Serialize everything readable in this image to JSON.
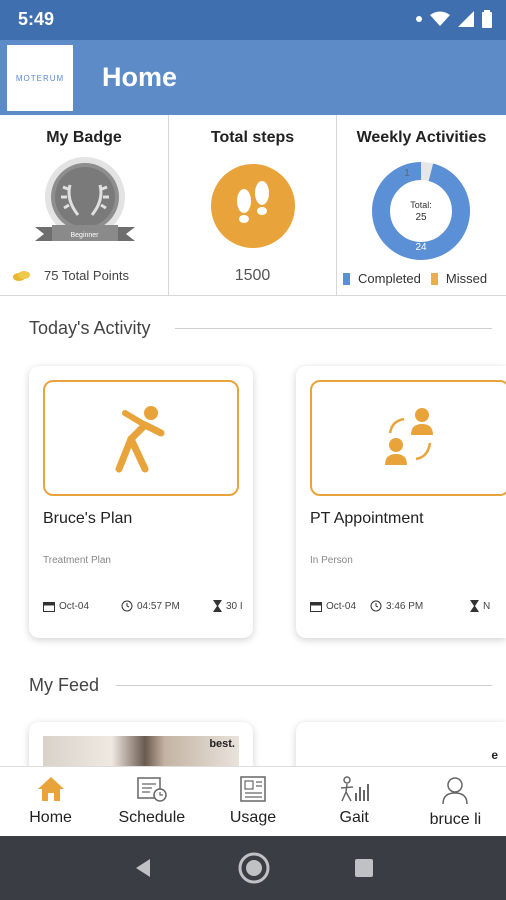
{
  "status_bar": {
    "time": "5:49"
  },
  "header": {
    "logo_text": "MOTERUM",
    "title": "Home"
  },
  "badge": {
    "title": "My Badge",
    "level": "Beginner",
    "points": "75 Total Points"
  },
  "steps": {
    "title": "Total steps",
    "count": "1500"
  },
  "weekly": {
    "title": "Weekly Activities",
    "total_label": "Total:",
    "total_value": "25",
    "completed_value": "24",
    "missed_value": "1",
    "completed_fraction": 0.96,
    "legend_completed": "Completed",
    "legend_missed": "Missed",
    "colors": {
      "completed": "#5b8fd6",
      "missed": "#e6e6e6",
      "missed_legend": "#e8b04c"
    }
  },
  "today_activity": {
    "heading": "Today's Activity",
    "cards": [
      {
        "title": "Bruce's Plan",
        "subtitle": "Treatment Plan",
        "date": "Oct-04",
        "time": "04:57 PM",
        "duration": "30 I",
        "icon": "stretching-figure-icon"
      },
      {
        "title": "PT Appointment",
        "subtitle": "In Person",
        "date": "Oct-04",
        "time": "3:46 PM",
        "duration": "N",
        "icon": "people-exchange-icon"
      }
    ]
  },
  "feed": {
    "heading": "My Feed",
    "brand_tag_1": "best.",
    "brand_tag_2": "e"
  },
  "nav": {
    "items": [
      {
        "label": "Home",
        "icon": "home-icon"
      },
      {
        "label": "Schedule",
        "icon": "schedule-icon"
      },
      {
        "label": "Usage",
        "icon": "usage-icon"
      },
      {
        "label": "Gait",
        "icon": "gait-icon"
      },
      {
        "label": "bruce li",
        "icon": "profile-icon"
      }
    ],
    "active_color": "#e8a43a"
  }
}
